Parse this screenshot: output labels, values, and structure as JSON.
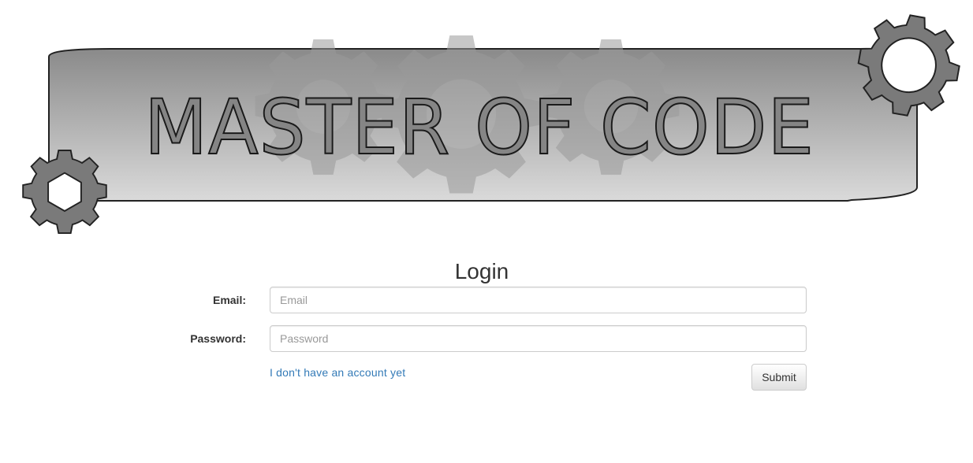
{
  "banner": {
    "title": "MASTER OF CODE"
  },
  "login": {
    "title": "Login",
    "email_label": "Email:",
    "email_placeholder": "Email",
    "email_value": "",
    "password_label": "Password:",
    "password_placeholder": "Password",
    "password_value": "",
    "account_link": "I don't have an account yet",
    "submit_label": "Submit"
  },
  "colors": {
    "banner_top": "#8c8c8c",
    "banner_bottom": "#d9d9d9",
    "gear_fill": "#7a7a7a",
    "link": "#337ab7"
  }
}
